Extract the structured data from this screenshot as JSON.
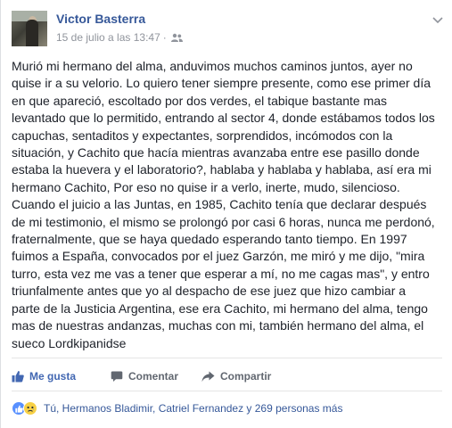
{
  "post": {
    "author": "Victor Basterra",
    "timestamp": "15 de julio a las 13:47",
    "separator": "·",
    "audience_icon": "friends-icon",
    "text": "Murió mi hermano del alma, anduvimos muchos caminos juntos, ayer no\nquise ir a su velorio. Lo quiero tener siempre presente, como ese primer día\nen que apareció, escoltado por dos verdes, el tabique bastante mas\nlevantado que lo permitido, entrando al sector 4, donde estábamos todos los\ncapuchas, sentaditos y expectantes, sorprendidos, incómodos con la\nsituación, y Cachito que hacía mientras avanzaba entre ese pasillo donde\nestaba la huevera y el laboratorio?, hablaba y hablaba y hablaba, así era mi\nhermano Cachito, Por eso no quise ir a verlo, inerte, mudo, silencioso.\nCuando el juicio a las Juntas, en 1985, Cachito tenía que declarar después\nde mi testimonio, el mismo se prolongó por casi 6 horas, nunca me perdonó,\nfraternalmente, que se haya quedado esperando tanto tiempo. En 1997\nfuimos a España, convocados por el juez Garzón, me miró y me dijo, \"mira\nturro, esta vez me vas a tener que esperar a mí, no me cagas mas\", y entro\ntriunfalmente antes que yo al despacho de ese juez que hizo cambiar a\nparte de la Justicia Argentina, ese era Cachito, mi hermano del alma, tengo\nmas de nuestras andanzas, muchas con mi, también hermano del alma, el\nsueco Lordkipanidse"
  },
  "actions": {
    "like": "Me gusta",
    "comment": "Comentar",
    "share": "Compartir"
  },
  "reactions": {
    "summary": "Tú, Hermanos Bladimir, Catriel Fernandez y 269 personas más",
    "icons": [
      "like-reaction-icon",
      "sad-reaction-icon"
    ]
  },
  "colors": {
    "link_blue": "#365899",
    "like_blue": "#4267b2",
    "meta_gray": "#90949c",
    "action_gray": "#616770"
  }
}
